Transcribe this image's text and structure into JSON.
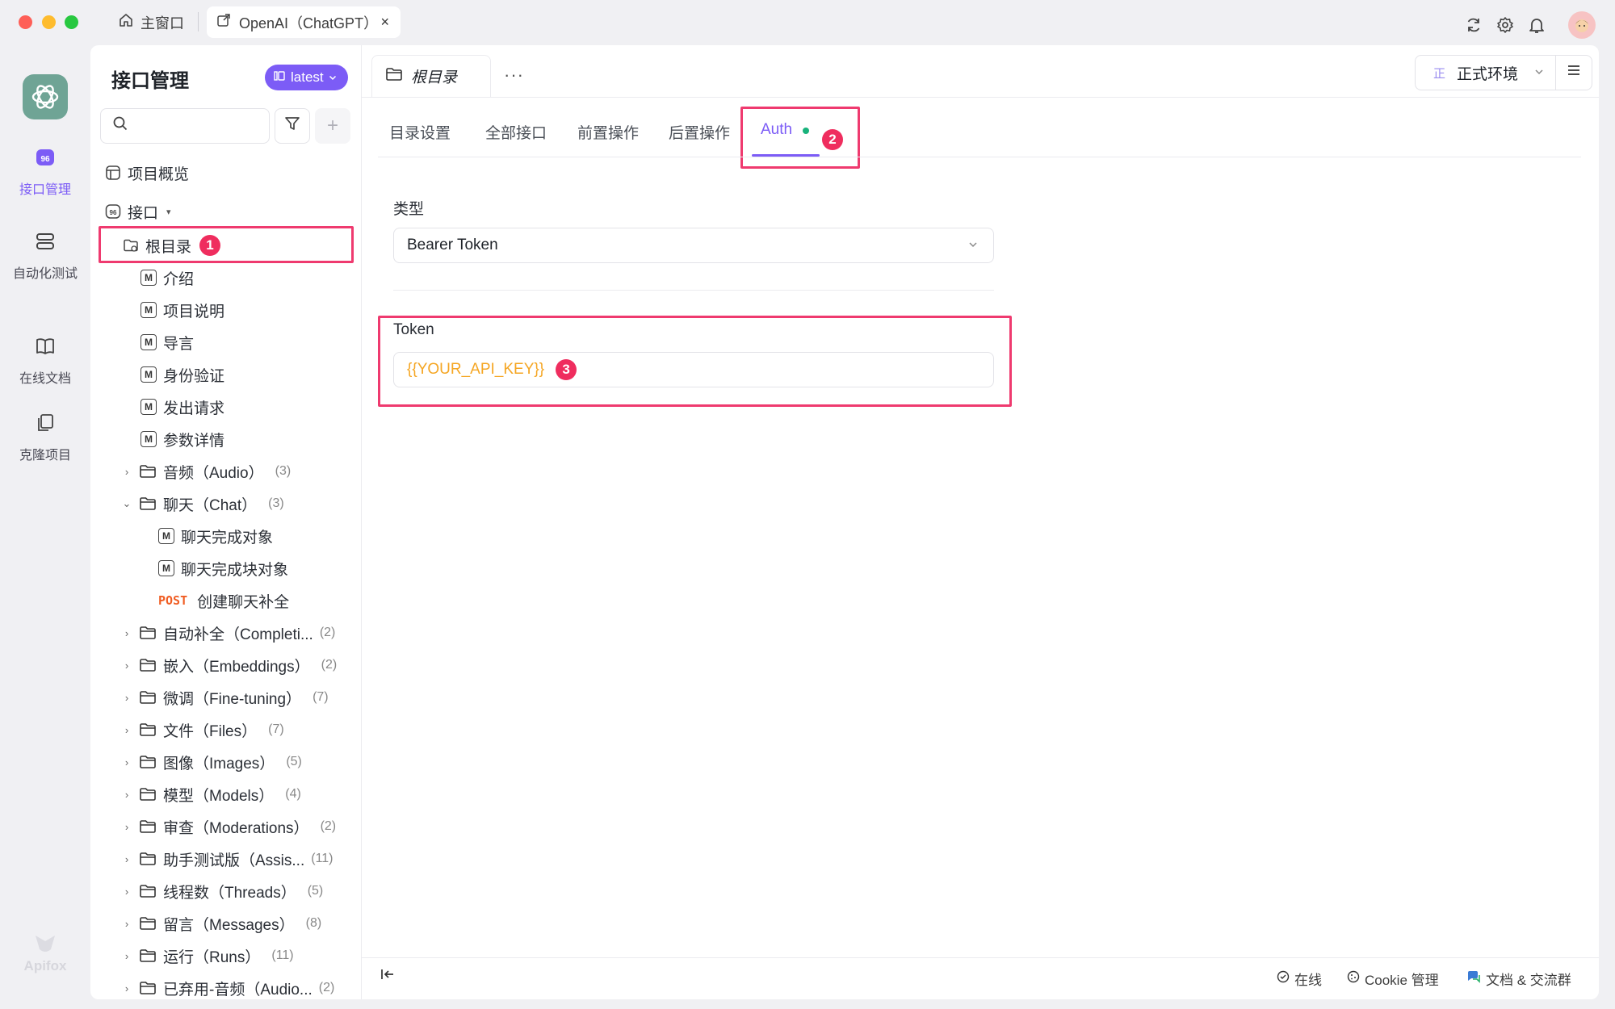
{
  "window": {
    "home_tab": "主窗口",
    "active_tab": "OpenAI（ChatGPT）",
    "close_glyph": "×"
  },
  "leftnav": {
    "items": [
      {
        "label": "接口管理",
        "icon": "api-icon"
      },
      {
        "label": "自动化测试",
        "icon": "automation-icon"
      },
      {
        "label": "在线文档",
        "icon": "book-icon"
      },
      {
        "label": "克隆项目",
        "icon": "clone-icon"
      }
    ],
    "footer": "Apifox"
  },
  "sidebar": {
    "title": "接口管理",
    "version_badge": "latest",
    "add_glyph": "+",
    "overview": "项目概览",
    "api_root": "接口",
    "root_folder": "根目录",
    "docs": [
      "介绍",
      "项目说明",
      "导言",
      "身份验证",
      "发出请求",
      "参数详情"
    ],
    "audio_folder": {
      "label": "音频（Audio）",
      "count": "(3)"
    },
    "chat_folder": {
      "label": "聊天（Chat）",
      "count": "(3)"
    },
    "chat_docs": [
      "聊天完成对象",
      "聊天完成块对象"
    ],
    "chat_post": {
      "method": "POST",
      "label": "创建聊天补全"
    },
    "folders": [
      {
        "label": "自动补全（Completi...",
        "count": "(2)"
      },
      {
        "label": "嵌入（Embeddings）",
        "count": "(2)"
      },
      {
        "label": "微调（Fine-tuning）",
        "count": "(7)"
      },
      {
        "label": "文件（Files）",
        "count": "(7)"
      },
      {
        "label": "图像（Images）",
        "count": "(5)"
      },
      {
        "label": "模型（Models）",
        "count": "(4)"
      },
      {
        "label": "审查（Moderations）",
        "count": "(2)"
      },
      {
        "label": "助手测试版（Assis...",
        "count": "(11)"
      },
      {
        "label": "线程数（Threads）",
        "count": "(5)"
      },
      {
        "label": "留言（Messages）",
        "count": "(8)"
      },
      {
        "label": "运行（Runs）",
        "count": "(11)"
      },
      {
        "label": "已弃用-音频（Audio...",
        "count": "(2)"
      }
    ]
  },
  "main": {
    "doc_tab": "根目录",
    "more_glyph": "···",
    "env_tag": "正",
    "env": "正式环境",
    "subtabs": [
      "目录设置",
      "全部接口",
      "前置操作",
      "后置操作",
      "Auth"
    ],
    "type_label": "类型",
    "type_value": "Bearer Token",
    "token_label": "Token",
    "token_value": "{{YOUR_API_KEY}}"
  },
  "badges": [
    "1",
    "2",
    "3"
  ],
  "footer": {
    "online": "在线",
    "cookie": "Cookie 管理",
    "docs": "文档 & 交流群"
  },
  "colors": {
    "accent": "#7c5cf6",
    "highlight": "#ef3a6f",
    "token": "#f5a623",
    "post": "#f05d23",
    "status_dot": "#18b27b"
  }
}
